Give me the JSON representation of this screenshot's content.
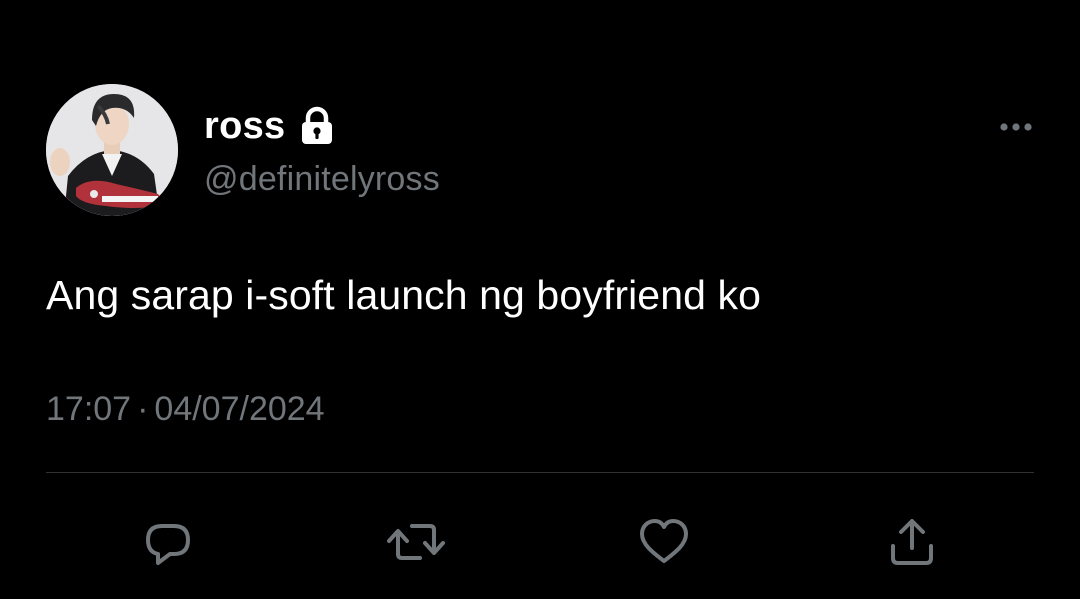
{
  "user": {
    "display_name": "ross",
    "handle": "@definitelyross",
    "protected_icon": "lock-icon",
    "avatar_icon": "profile-photo"
  },
  "tweet": {
    "text": "Ang sarap i-soft launch ng boyfriend ko",
    "time": "17:07",
    "separator": "·",
    "date": "04/07/2024"
  },
  "actions": {
    "reply_icon": "reply-icon",
    "retweet_icon": "retweet-icon",
    "like_icon": "heart-icon",
    "share_icon": "share-icon",
    "more_icon": "more-icon"
  },
  "colors": {
    "background": "#000000",
    "primary_text": "#ffffff",
    "secondary_text": "#71767b",
    "divider": "#2f3336"
  }
}
